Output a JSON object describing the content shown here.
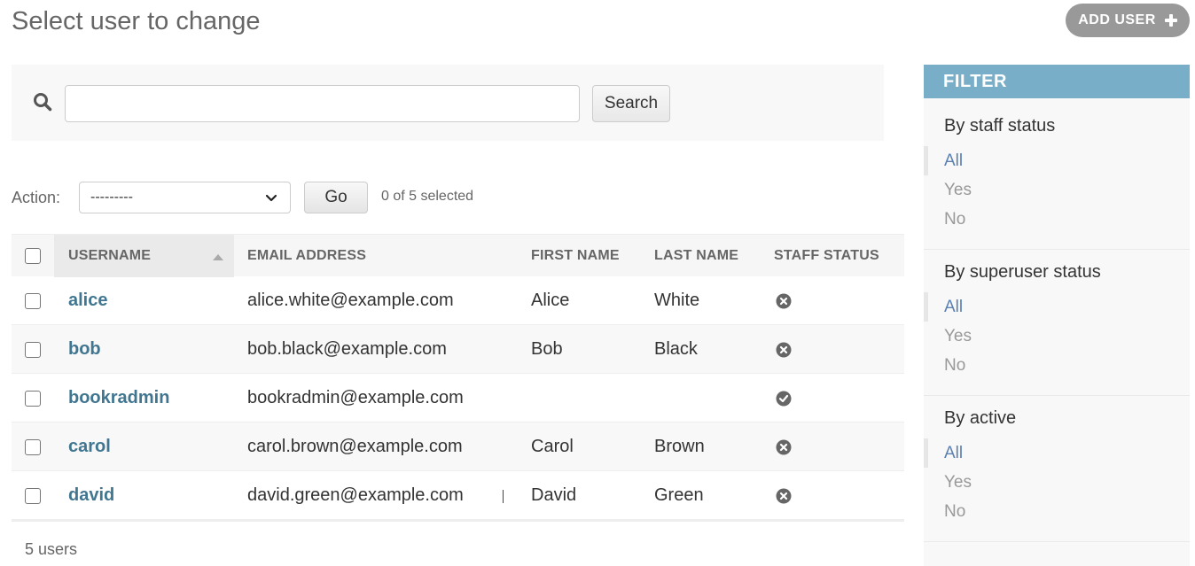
{
  "page": {
    "title": "Select user to change"
  },
  "toolbar": {
    "add_user_label": "ADD USER"
  },
  "search": {
    "button_label": "Search",
    "value": "",
    "placeholder": ""
  },
  "actions": {
    "label": "Action:",
    "selected_option": "---------",
    "go_label": "Go",
    "selection_text": "0 of 5 selected"
  },
  "table": {
    "columns": [
      "USERNAME",
      "EMAIL ADDRESS",
      "FIRST NAME",
      "LAST NAME",
      "STAFF STATUS"
    ],
    "sorted_column": "USERNAME",
    "rows": [
      {
        "username": "alice",
        "email": "alice.white@example.com",
        "first_name": "Alice",
        "last_name": "White",
        "staff_status": false
      },
      {
        "username": "bob",
        "email": "bob.black@example.com",
        "first_name": "Bob",
        "last_name": "Black",
        "staff_status": false
      },
      {
        "username": "bookradmin",
        "email": "bookradmin@example.com",
        "first_name": "",
        "last_name": "",
        "staff_status": true
      },
      {
        "username": "carol",
        "email": "carol.brown@example.com",
        "first_name": "Carol",
        "last_name": "Brown",
        "staff_status": false
      },
      {
        "username": "david",
        "email": "david.green@example.com",
        "first_name": "David",
        "last_name": "Green",
        "staff_status": false
      }
    ],
    "result_count": "5 users"
  },
  "filter": {
    "title": "FILTER",
    "sections": [
      {
        "heading": "By staff status",
        "options": [
          "All",
          "Yes",
          "No"
        ],
        "selected": "All"
      },
      {
        "heading": "By superuser status",
        "options": [
          "All",
          "Yes",
          "No"
        ],
        "selected": "All"
      },
      {
        "heading": "By active",
        "options": [
          "All",
          "Yes",
          "No"
        ],
        "selected": "All"
      }
    ]
  },
  "icons": {
    "search": "search-icon",
    "add": "plus-icon",
    "sort": "sort-asc-icon",
    "yes": "check-circle-icon",
    "no": "x-circle-icon",
    "dropdown": "chevron-down-icon"
  },
  "colors": {
    "link": "#417690",
    "filter_header": "#79aec8",
    "filter_selected": "#5b80b2",
    "add_button": "#999999"
  }
}
